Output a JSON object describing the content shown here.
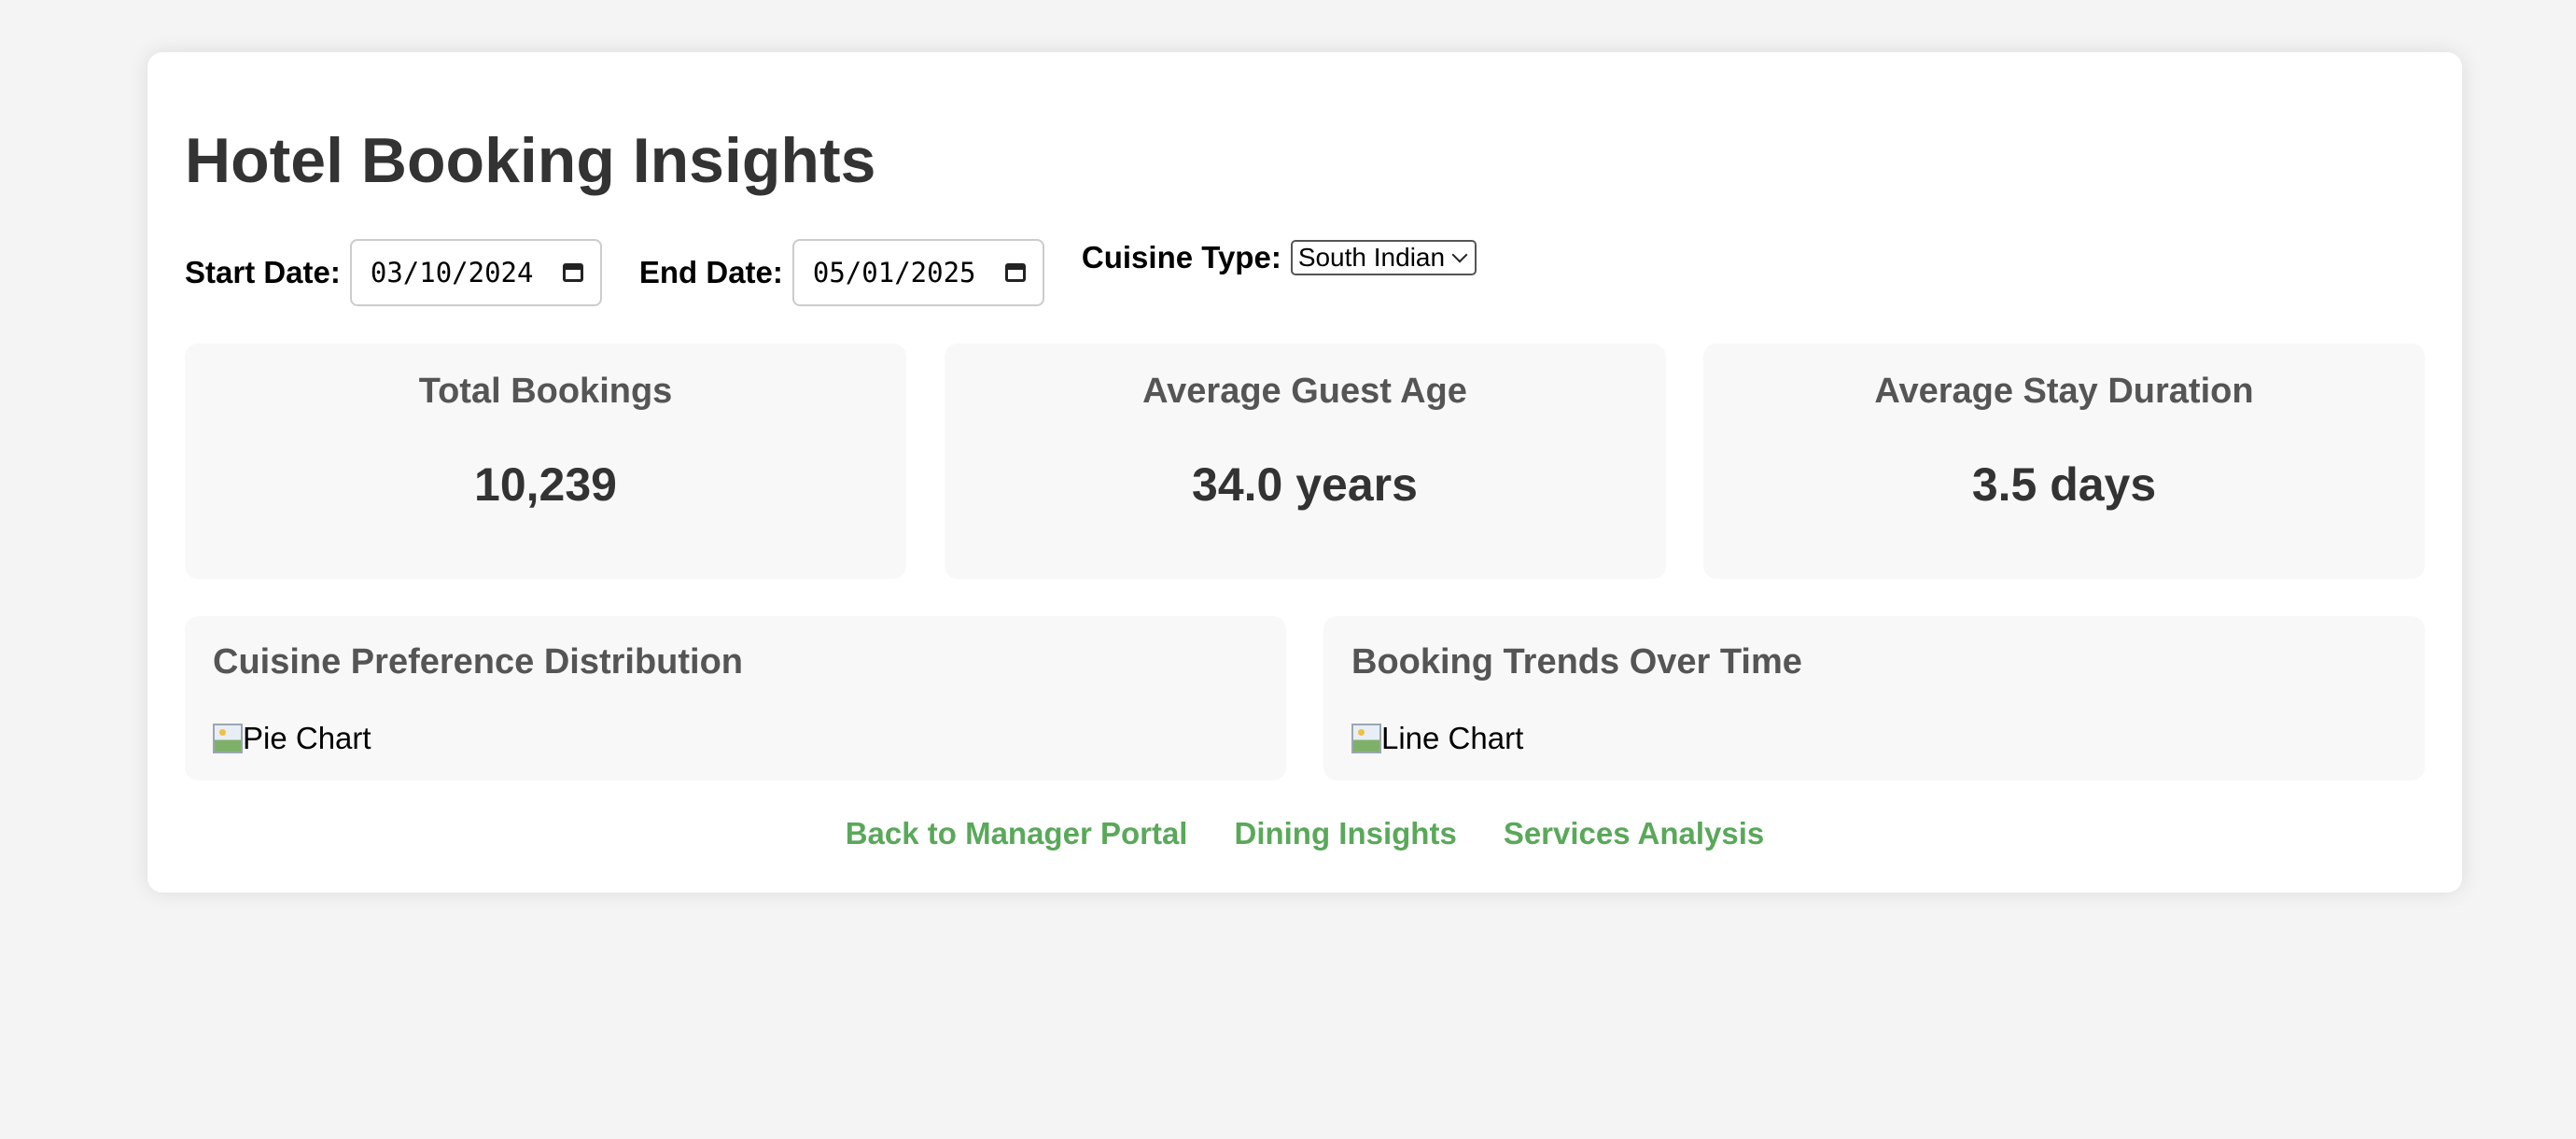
{
  "page": {
    "title": "Hotel Booking Insights"
  },
  "filters": {
    "start_date_label": "Start Date:",
    "start_date_value": "03/10/2024",
    "end_date_label": "End Date:",
    "end_date_value": "05/01/2025",
    "cuisine_label": "Cuisine Type:",
    "cuisine_value": "South Indian"
  },
  "stats": [
    {
      "title": "Total Bookings",
      "value": "10,239"
    },
    {
      "title": "Average Guest Age",
      "value": "34.0 years"
    },
    {
      "title": "Average Stay Duration",
      "value": "3.5 days"
    }
  ],
  "charts": [
    {
      "title": "Cuisine Preference Distribution",
      "alt": "Pie Chart"
    },
    {
      "title": "Booking Trends Over Time",
      "alt": "Line Chart"
    }
  ],
  "links": [
    {
      "label": "Back to Manager Portal"
    },
    {
      "label": "Dining Insights"
    },
    {
      "label": "Services Analysis"
    }
  ],
  "colors": {
    "background": "#f4f4f4",
    "card": "#ffffff",
    "panel": "#f8f8f8",
    "link": "#5aa85a",
    "heading": "#333333",
    "subheading": "#555555"
  },
  "icons": {
    "date_picker": "calendar-icon",
    "select": "chevron-down-icon",
    "broken_image": "broken-image-icon"
  }
}
